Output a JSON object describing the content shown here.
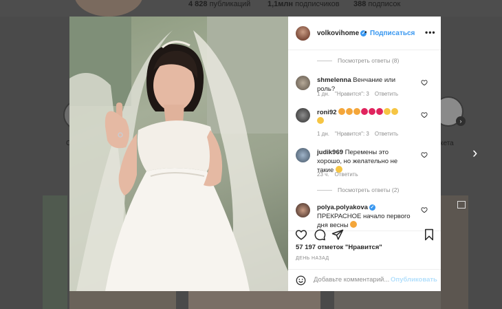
{
  "profile_bg": {
    "stats": [
      {
        "value": "4 828",
        "label": "публикаций"
      },
      {
        "value": "1,1млн",
        "label": "подписчиков"
      },
      {
        "value": "388",
        "label": "подписок"
      }
    ],
    "highlight_left_label": "С",
    "highlight_right_label": "кета"
  },
  "post": {
    "author": "volkovihome",
    "follow_label": "Подписаться",
    "header_dot": "•",
    "more_label": "•••",
    "comments": [
      {
        "type": "replies",
        "label": "Посмотреть ответы (8)"
      },
      {
        "type": "comment",
        "user": "shmelenna",
        "text": "Венчание или роль?",
        "time": "1 дн.",
        "likes": "\"Нравится\": 3",
        "reply": "Ответить"
      },
      {
        "type": "comment",
        "user": "roni92",
        "text": "",
        "time": "1 дн.",
        "likes": "\"Нравится\": 3",
        "reply": "Ответить"
      },
      {
        "type": "comment",
        "user": "judik969",
        "text": "Перемены это хорошо, но желательно не такие",
        "time": "23 ч.",
        "reply": "Ответить"
      },
      {
        "type": "replies",
        "label": "Посмотреть ответы (2)"
      },
      {
        "type": "comment",
        "user": "polya.polyakova",
        "text": "ПРЕКРАСНОЕ начало первого дня весны"
      }
    ],
    "likes_text": "57 197 отметок \"Нравится\"",
    "time_label": "ДЕНЬ НАЗАД",
    "add_comment_placeholder": "Добавьте комментарий...",
    "post_button": "Опубликовать",
    "colors": {
      "accent": "#3897f0",
      "post_disabled": "#b2dffc"
    },
    "icons": [
      "heart-icon",
      "comment-icon",
      "share-icon",
      "bookmark-icon",
      "emoji-icon",
      "verified-icon"
    ]
  }
}
